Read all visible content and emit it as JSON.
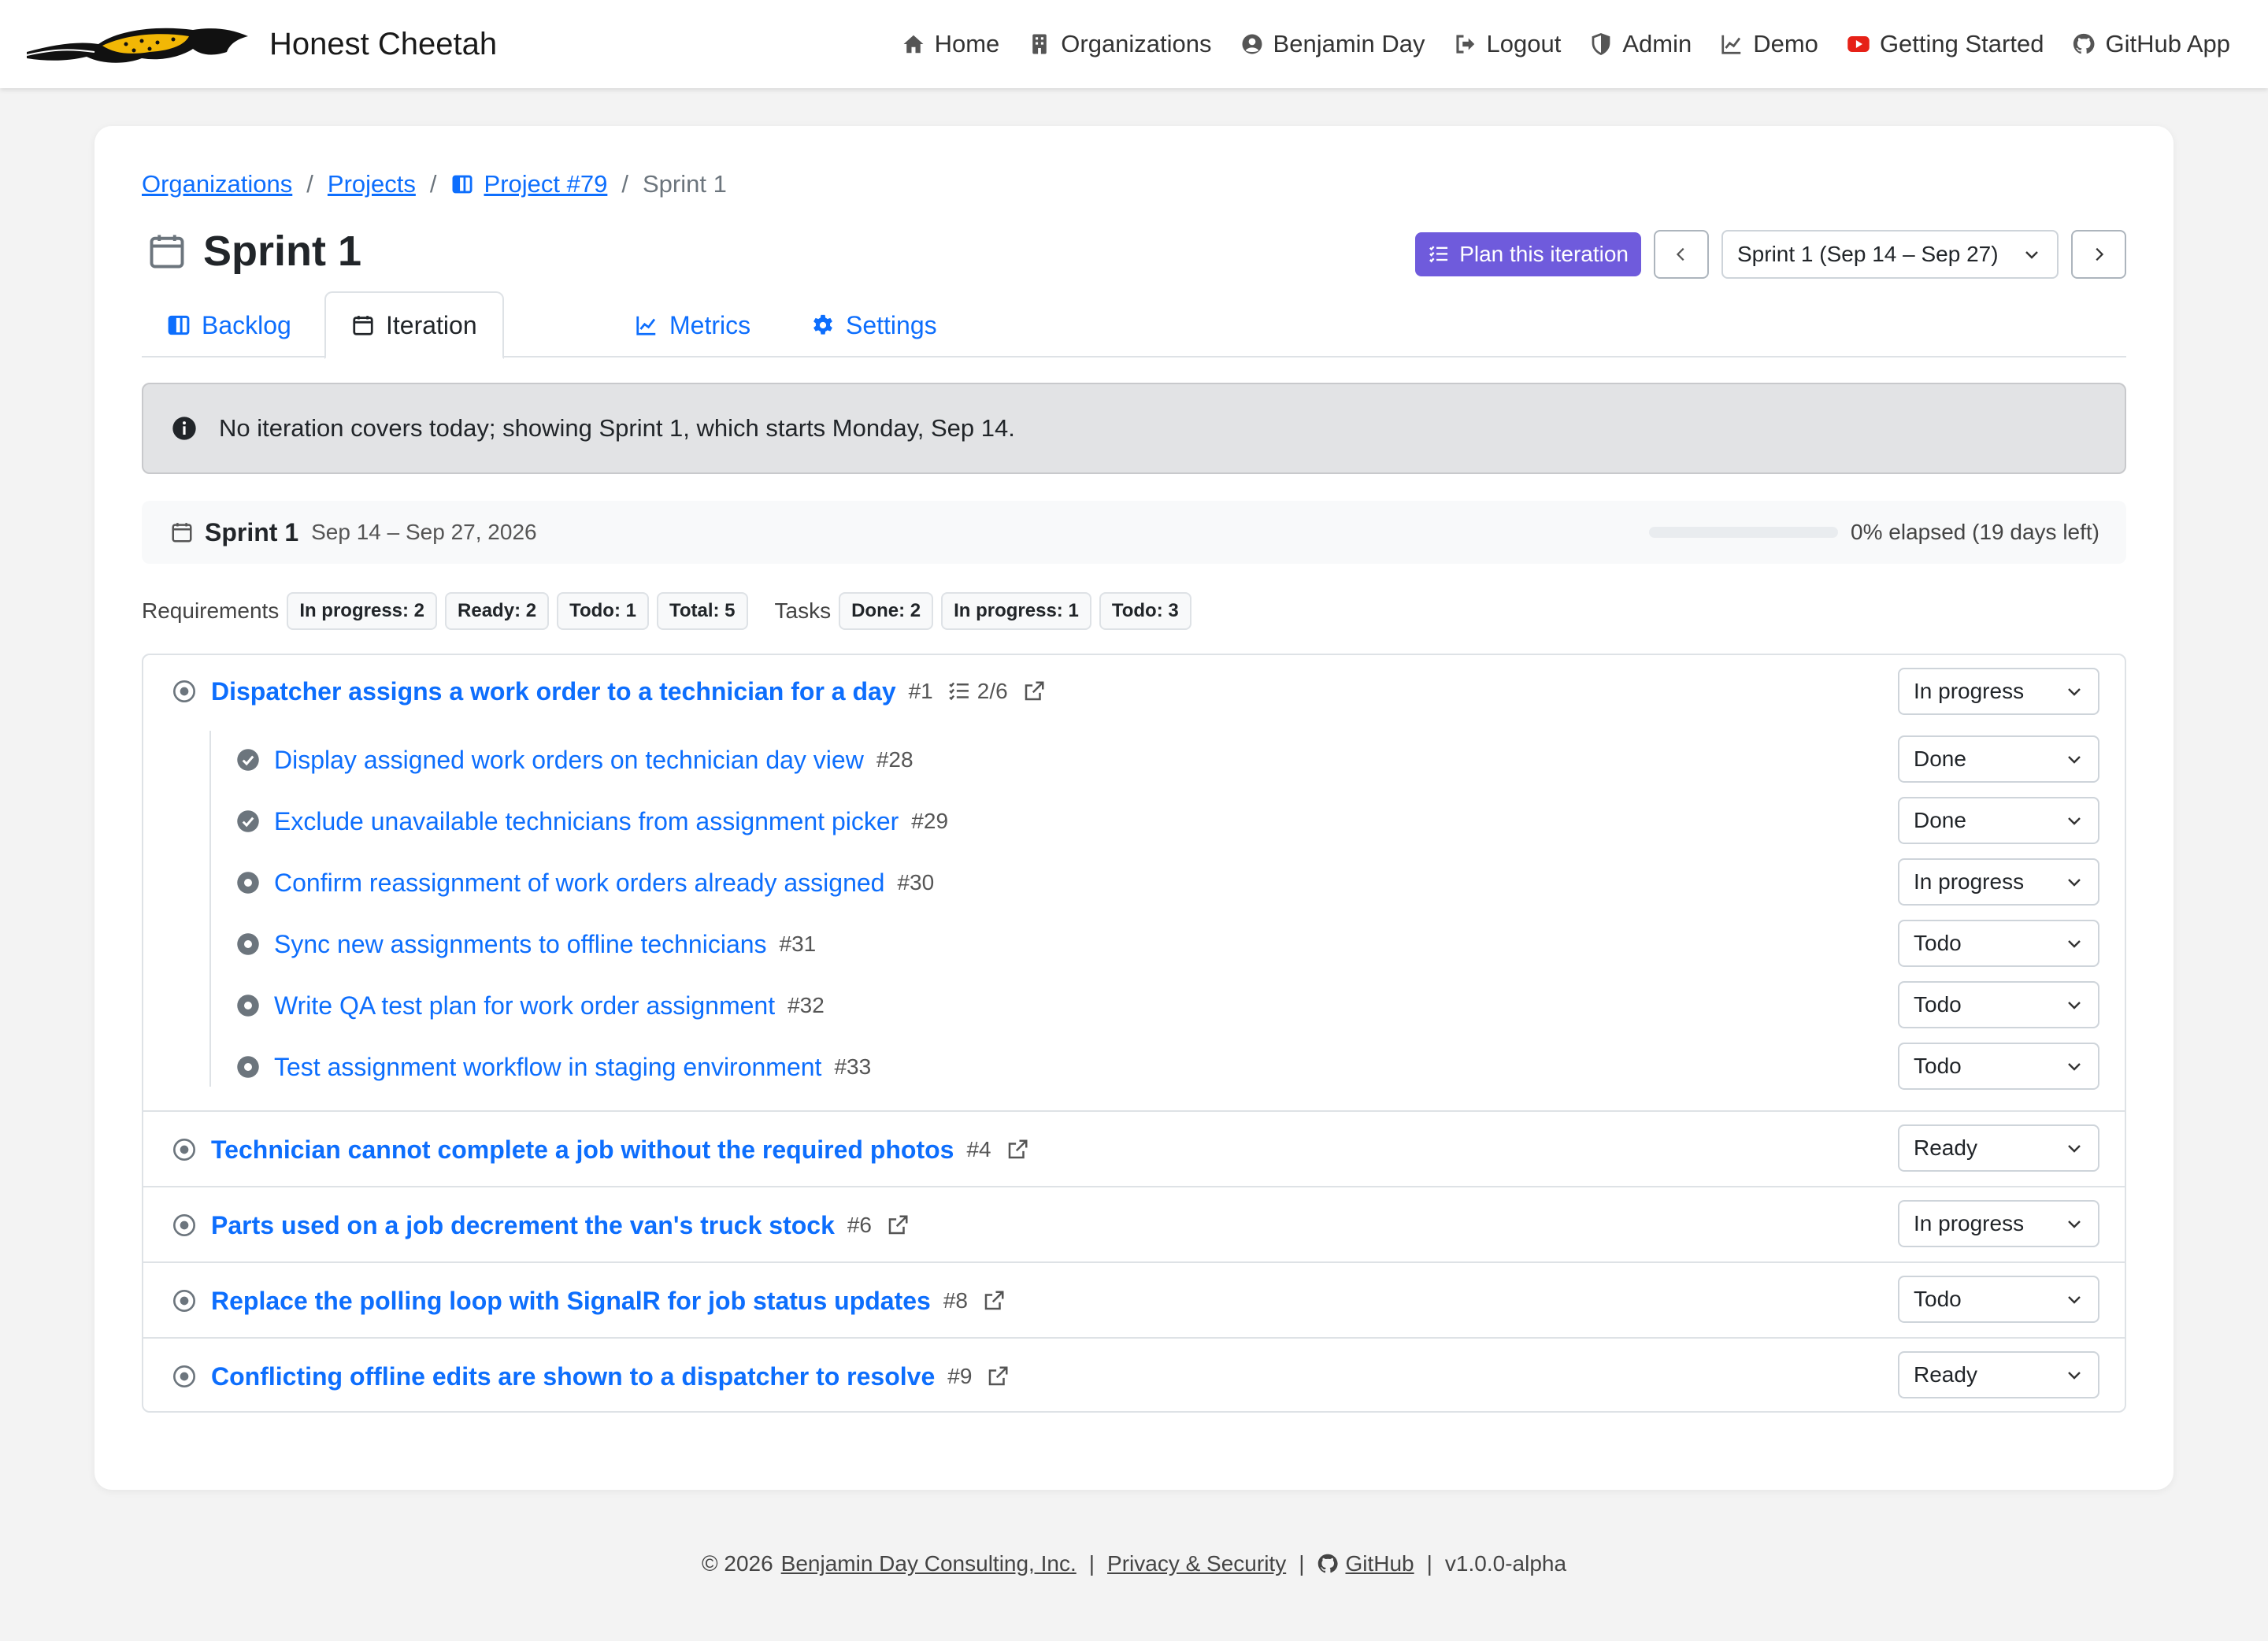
{
  "app": {
    "brand_name": "Honest Cheetah"
  },
  "nav": {
    "items": [
      {
        "label": "Home",
        "icon": "home-icon"
      },
      {
        "label": "Organizations",
        "icon": "building-icon"
      },
      {
        "label": "Benjamin Day",
        "icon": "user-circle-icon"
      },
      {
        "label": "Logout",
        "icon": "logout-icon"
      },
      {
        "label": "Admin",
        "icon": "shield-icon"
      },
      {
        "label": "Demo",
        "icon": "chart-line-icon"
      },
      {
        "label": "Getting Started",
        "icon": "youtube-icon"
      },
      {
        "label": "GitHub App",
        "icon": "github-icon"
      }
    ]
  },
  "breadcrumb": {
    "items": [
      "Organizations",
      "Projects",
      "Project #79"
    ],
    "current": "Sprint 1",
    "separator": "/"
  },
  "page": {
    "title": "Sprint 1",
    "plan_button": "Plan this iteration",
    "iteration_select": "Sprint 1 (Sep 14 – Sep 27)"
  },
  "tabs": [
    {
      "label": "Backlog",
      "icon": "board-icon"
    },
    {
      "label": "Iteration",
      "icon": "calendar-icon",
      "active": true
    },
    {
      "label": "Metrics",
      "icon": "chart-line-icon"
    },
    {
      "label": "Settings",
      "icon": "gear-icon"
    }
  ],
  "alert": {
    "text": "No iteration covers today; showing Sprint 1, which starts Monday, Sep 14."
  },
  "sprint": {
    "name": "Sprint 1",
    "dates": "Sep 14 – Sep 27, 2026",
    "elapsed_fraction": 0,
    "elapsed_label": "0% elapsed (19 days left)"
  },
  "counts": {
    "requirements_label": "Requirements",
    "requirements": [
      "In progress: 2",
      "Ready: 2",
      "Todo: 1",
      "Total: 5"
    ],
    "tasks_label": "Tasks",
    "tasks": [
      "Done: 2",
      "In progress: 1",
      "Todo: 3"
    ]
  },
  "requirements": [
    {
      "title": "Dispatcher assigns a work order to a technician for a day",
      "number": "#1",
      "task_progress": "2/6",
      "status": "In progress",
      "tasks": [
        {
          "title": "Display assigned work orders on technician day view",
          "number": "#28",
          "status": "Done"
        },
        {
          "title": "Exclude unavailable technicians from assignment picker",
          "number": "#29",
          "status": "Done"
        },
        {
          "title": "Confirm reassignment of work orders already assigned",
          "number": "#30",
          "status": "In progress"
        },
        {
          "title": "Sync new assignments to offline technicians",
          "number": "#31",
          "status": "Todo"
        },
        {
          "title": "Write QA test plan for work order assignment",
          "number": "#32",
          "status": "Todo"
        },
        {
          "title": "Test assignment workflow in staging environment",
          "number": "#33",
          "status": "Todo"
        }
      ]
    },
    {
      "title": "Technician cannot complete a job without the required photos",
      "number": "#4",
      "status": "Ready"
    },
    {
      "title": "Parts used on a job decrement the van's truck stock",
      "number": "#6",
      "status": "In progress"
    },
    {
      "title": "Replace the polling loop with SignalR for job status updates",
      "number": "#8",
      "status": "Todo"
    },
    {
      "title": "Conflicting offline edits are shown to a dispatcher to resolve",
      "number": "#9",
      "status": "Ready"
    }
  ],
  "footer": {
    "copyright": "© 2026",
    "company": "Benjamin Day Consulting, Inc.",
    "privacy": "Privacy & Security",
    "github": "GitHub",
    "version": "v1.0.0-alpha",
    "separator": "|"
  },
  "colors": {
    "link": "#0d6efd",
    "plan_button": "#6f5bdc",
    "alert_bg": "#e2e3e5",
    "logo_yellow": "#f2b705",
    "youtube_red": "#e62117"
  }
}
